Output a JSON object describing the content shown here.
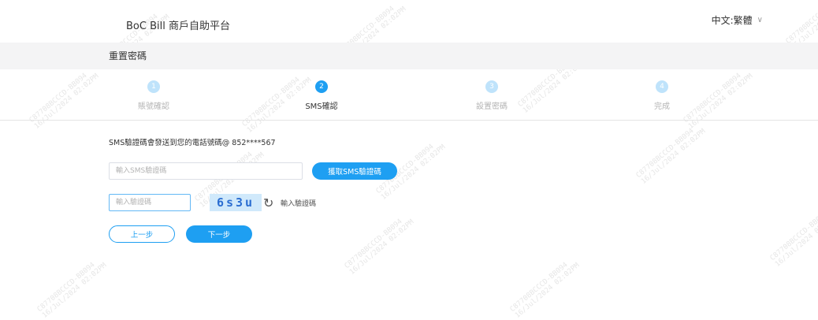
{
  "header": {
    "brand": "BoC Bill 商戶自助平台",
    "language": "中文:繁體"
  },
  "page_title": "重置密碼",
  "steps": [
    {
      "num": "1",
      "label": "賬號確認"
    },
    {
      "num": "2",
      "label": "SMS確認"
    },
    {
      "num": "3",
      "label": "設置密碼"
    },
    {
      "num": "4",
      "label": "完成"
    }
  ],
  "sms": {
    "info": "SMS驗證碼會發送到您的電話號碼@ 852****567",
    "input_placeholder": "輸入SMS驗證碼",
    "get_code_button": "獲取SMS驗證碼"
  },
  "captcha": {
    "input_placeholder": "輸入驗證碼",
    "code": "6s3u",
    "label": "輸入驗證碼"
  },
  "buttons": {
    "prev": "上一步",
    "next": "下一步"
  },
  "watermark": {
    "line1": "C87708BCCCD-BB094",
    "line2": "16/Jul/2024 02:02PM"
  }
}
